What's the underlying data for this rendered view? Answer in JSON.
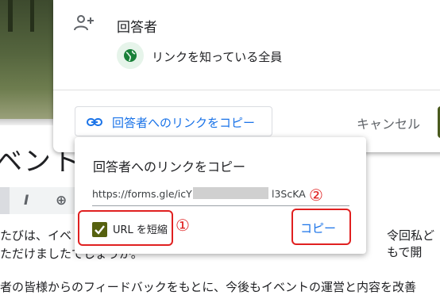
{
  "background": {
    "heading_fragment": "ベント",
    "toolbar_glyphs": [
      "I",
      "⊕"
    ],
    "body_lines": [
      "たびは、イベ",
      "令回私どもで開",
      "ただけましたでしょうか。",
      "者の皆様からのフィードバックをもとに、今後もイベントの運営と内容を改善"
    ]
  },
  "dialog": {
    "responders_label": "回答者",
    "link_scope": "リンクを知っている全員",
    "copy_link_button": "回答者へのリンクをコピー",
    "cancel_button": "キャンセル"
  },
  "popup": {
    "title": "回答者へのリンクをコピー",
    "url_prefix": "https://forms.gle/icY",
    "url_suffix": "l3ScKA",
    "shorten_url_label": "URL を短縮",
    "shorten_url_checked": true,
    "copy_button": "コピー"
  },
  "annotations": {
    "marker_1": "①",
    "marker_2": "②",
    "color": "#e02020"
  },
  "colors": {
    "accent_blue": "#1a73e8",
    "checkbox_fill": "#56610f",
    "globe_bg": "#e6f4ea",
    "globe_fg": "#188038"
  },
  "icons": [
    "person-add-icon",
    "globe-icon",
    "link-icon",
    "check-icon",
    "italic-icon",
    "insert-link-icon"
  ]
}
